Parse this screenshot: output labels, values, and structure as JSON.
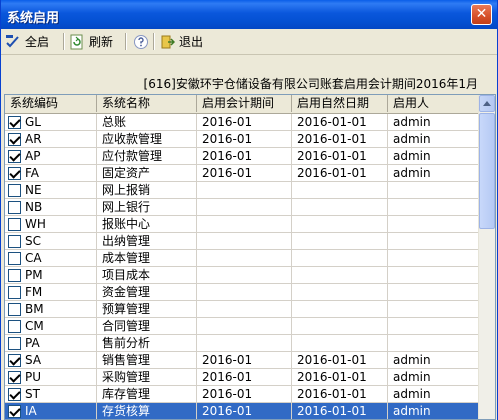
{
  "window": {
    "title": "系统启用",
    "close_symbol": "✕"
  },
  "toolbar": {
    "enable_all_label": "全启",
    "refresh_label": "刷新",
    "exit_label": "退出"
  },
  "info_line": "[616]安徽环宇仓储设备有限公司账套启用会计期间2016年1月",
  "table": {
    "headers": [
      "系统编码",
      "系统名称",
      "启用会计期间",
      "启用自然日期",
      "启用人"
    ],
    "rows": [
      {
        "checked": true,
        "code": "GL",
        "name": "总账",
        "period": "2016-01",
        "date": "2016-01-01",
        "user": "admin"
      },
      {
        "checked": true,
        "code": "AR",
        "name": "应收款管理",
        "period": "2016-01",
        "date": "2016-01-01",
        "user": "admin"
      },
      {
        "checked": true,
        "code": "AP",
        "name": "应付款管理",
        "period": "2016-01",
        "date": "2016-01-01",
        "user": "admin"
      },
      {
        "checked": true,
        "code": "FA",
        "name": "固定资产",
        "period": "2016-01",
        "date": "2016-01-01",
        "user": "admin"
      },
      {
        "checked": false,
        "code": "NE",
        "name": "网上报销",
        "period": "",
        "date": "",
        "user": ""
      },
      {
        "checked": false,
        "code": "NB",
        "name": "网上银行",
        "period": "",
        "date": "",
        "user": ""
      },
      {
        "checked": false,
        "code": "WH",
        "name": "报账中心",
        "period": "",
        "date": "",
        "user": ""
      },
      {
        "checked": false,
        "code": "SC",
        "name": "出纳管理",
        "period": "",
        "date": "",
        "user": ""
      },
      {
        "checked": false,
        "code": "CA",
        "name": "成本管理",
        "period": "",
        "date": "",
        "user": ""
      },
      {
        "checked": false,
        "code": "PM",
        "name": "项目成本",
        "period": "",
        "date": "",
        "user": ""
      },
      {
        "checked": false,
        "code": "FM",
        "name": "资金管理",
        "period": "",
        "date": "",
        "user": ""
      },
      {
        "checked": false,
        "code": "BM",
        "name": "预算管理",
        "period": "",
        "date": "",
        "user": ""
      },
      {
        "checked": false,
        "code": "CM",
        "name": "合同管理",
        "period": "",
        "date": "",
        "user": ""
      },
      {
        "checked": false,
        "code": "PA",
        "name": "售前分析",
        "period": "",
        "date": "",
        "user": ""
      },
      {
        "checked": true,
        "code": "SA",
        "name": "销售管理",
        "period": "2016-01",
        "date": "2016-01-01",
        "user": "admin"
      },
      {
        "checked": true,
        "code": "PU",
        "name": "采购管理",
        "period": "2016-01",
        "date": "2016-01-01",
        "user": "admin"
      },
      {
        "checked": true,
        "code": "ST",
        "name": "库存管理",
        "period": "2016-01",
        "date": "2016-01-01",
        "user": "admin"
      },
      {
        "checked": true,
        "code": "IA",
        "name": "存货核算",
        "period": "2016-01",
        "date": "2016-01-01",
        "user": "admin",
        "selected": true
      }
    ]
  },
  "colors": {
    "title_bar": "#0a57dc",
    "selection": "#316ac5",
    "window_bg": "#ece9d8"
  }
}
